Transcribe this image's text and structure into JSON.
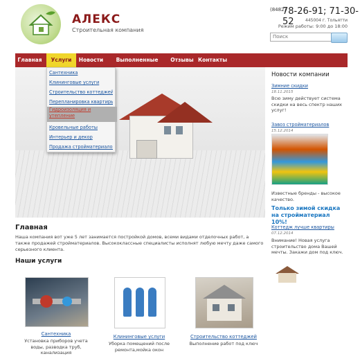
{
  "header": {
    "brand": "АЛЕКС",
    "subtitle": "Строительная компания",
    "phone_code": "(8482)",
    "phones": "78-26-91; 71-30-52",
    "address": "445004 г. Тольятти",
    "hours": "Режим работы: 9:00 до 18:00",
    "search_placeholder": "Поиск"
  },
  "nav": {
    "items": [
      "Главная",
      "Услуги",
      "Новости",
      "Выполненные работы",
      "Отзывы",
      "Контакты"
    ],
    "active": "Услуги"
  },
  "dropdown": {
    "items": [
      "Сантехника",
      "Клининговые услуги",
      "Строительство коттеджей",
      "Перепланировка квартиры",
      "Гидроизоляция и утепление",
      "Кровельные работы",
      "Интерьер и декор",
      "Продажа стройматериалов"
    ],
    "highlighted": "Гидроизоляция и утепление"
  },
  "main": {
    "title": "Главная",
    "intro": "Наша компания вот уже 5 лет занимается постройкой домов, всеми видами отделочных работ, а также продажей стройматериалов. Высококлассные специалисты исполнят любую мечту даже самого серьезного клиента.",
    "services_title": "Наши услуги",
    "services": [
      {
        "link": "Сантехника",
        "desc": "Установка приборов учета воды, разводка труб, канализация"
      },
      {
        "link": "Клининговые услуги",
        "desc": "Уборка помещений после ремонта,мойка окон"
      },
      {
        "link": "Строительство коттеджей",
        "desc": "Выполнение работ под ключ"
      }
    ]
  },
  "sidebar": {
    "title": "Новости компании",
    "news": [
      {
        "link": "Зимние скидки",
        "date": "18.11.2015",
        "text": "Всю зиму действует система скидки на весь спектр наших услуг!"
      },
      {
        "link": "Завоз стройматериалов",
        "date": "15.12.2014",
        "text": "Известные бренды - высокое качество."
      },
      {
        "link": "Коттедж лучше квартиры",
        "date": "07.12.2014",
        "text": "Внимание! Новая услуга строительство дома Вашей мечты. Закажи дом под ключ."
      }
    ],
    "promo": "Только зимой скидка на стройматериал 10%!"
  },
  "colors": {
    "nav_bg": "#a9282a",
    "nav_active": "#f0d62b",
    "brand": "#8b1a1a",
    "link": "#1a55a0"
  }
}
